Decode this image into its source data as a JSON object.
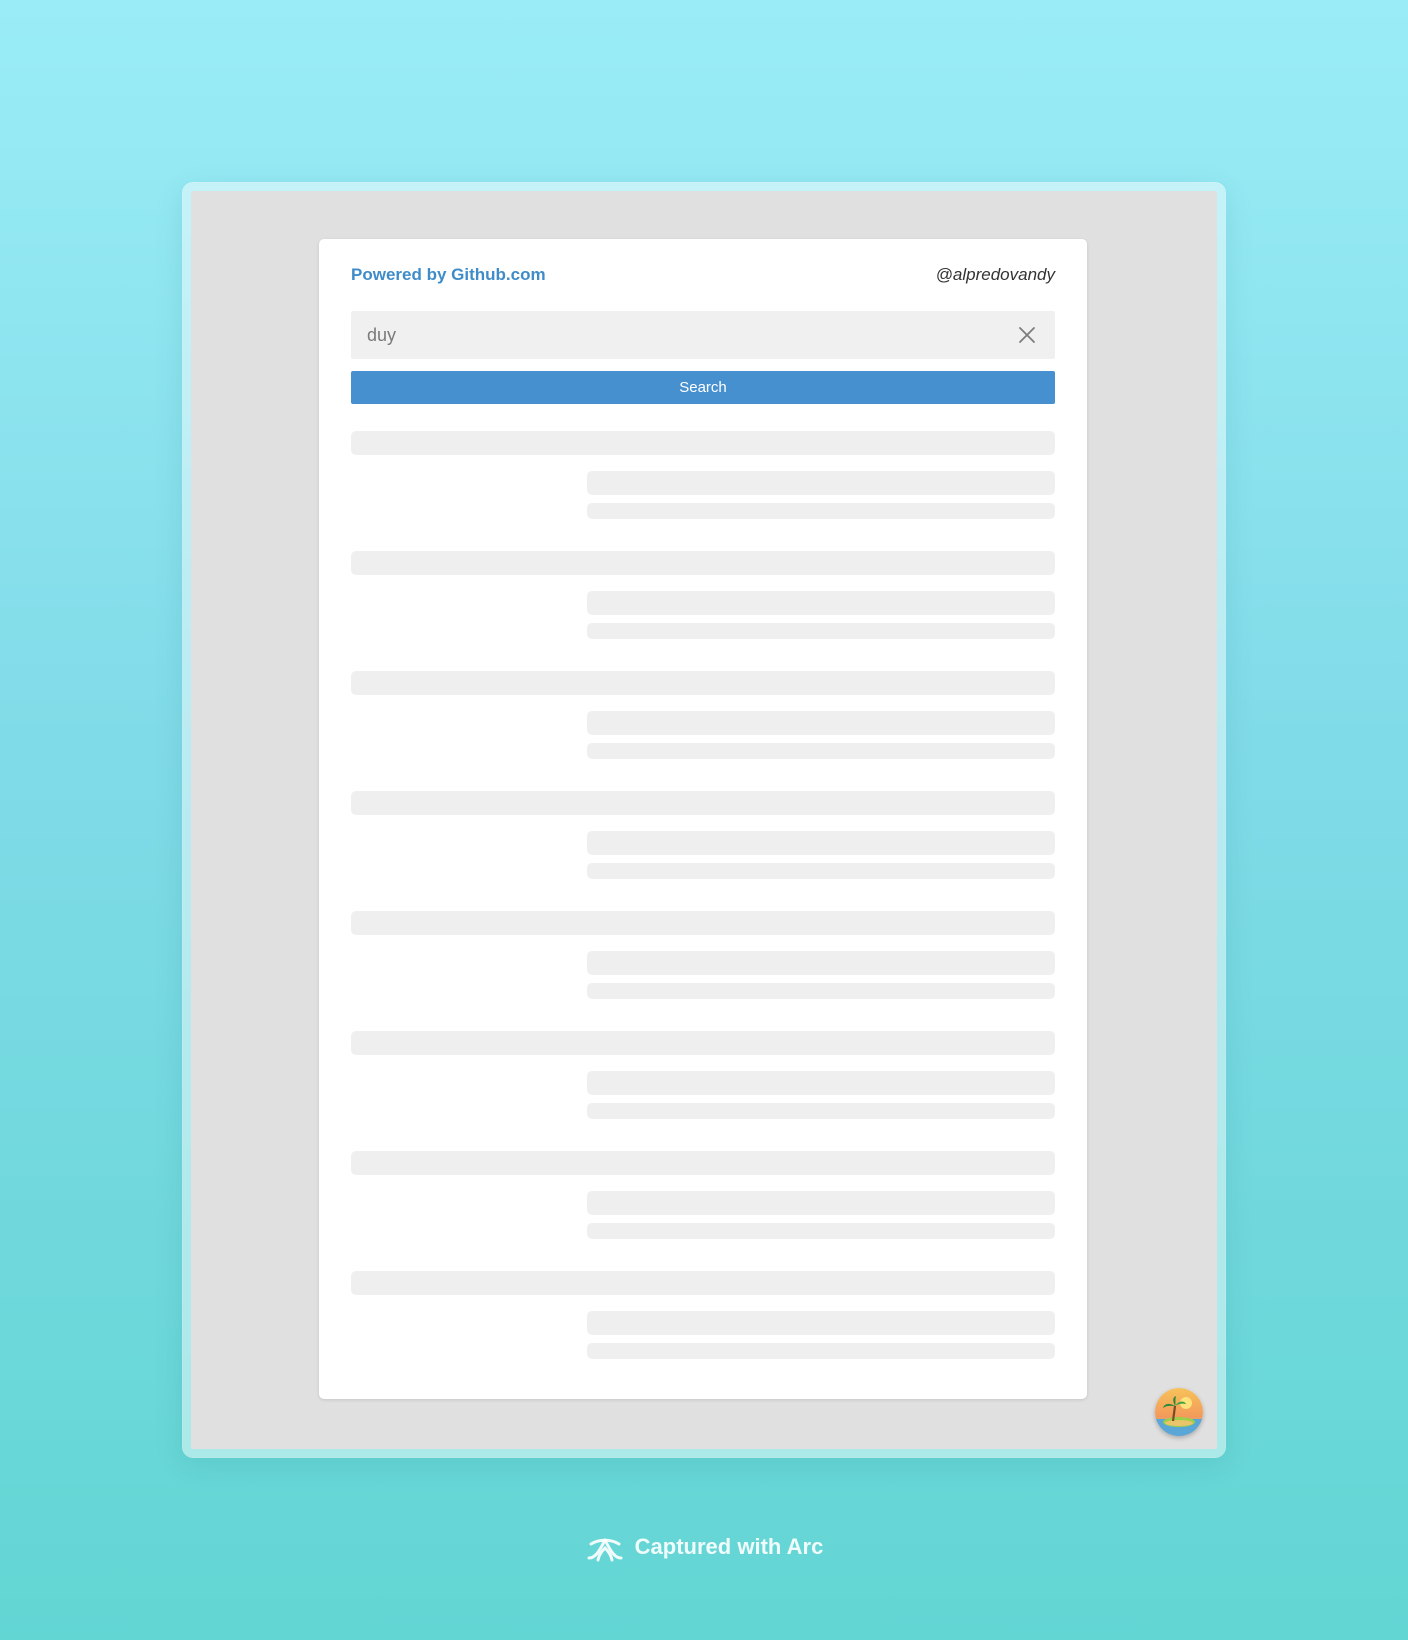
{
  "header": {
    "powered_by": "Powered by Github.com",
    "author_handle": "@alpredovandy"
  },
  "search": {
    "value": "duy",
    "button_label": "Search"
  },
  "results": {
    "state": "loading",
    "placeholder_count": 8
  },
  "icons": {
    "clear": "close-icon",
    "avatar": "island-avatar",
    "footer_logo": "arc-logo-icon"
  },
  "colors": {
    "accent": "#4690d0",
    "link": "#3f8cc9",
    "skeleton": "#efefef",
    "page_background": "#e0e0e0"
  },
  "footer": {
    "text": "Captured with Arc"
  }
}
